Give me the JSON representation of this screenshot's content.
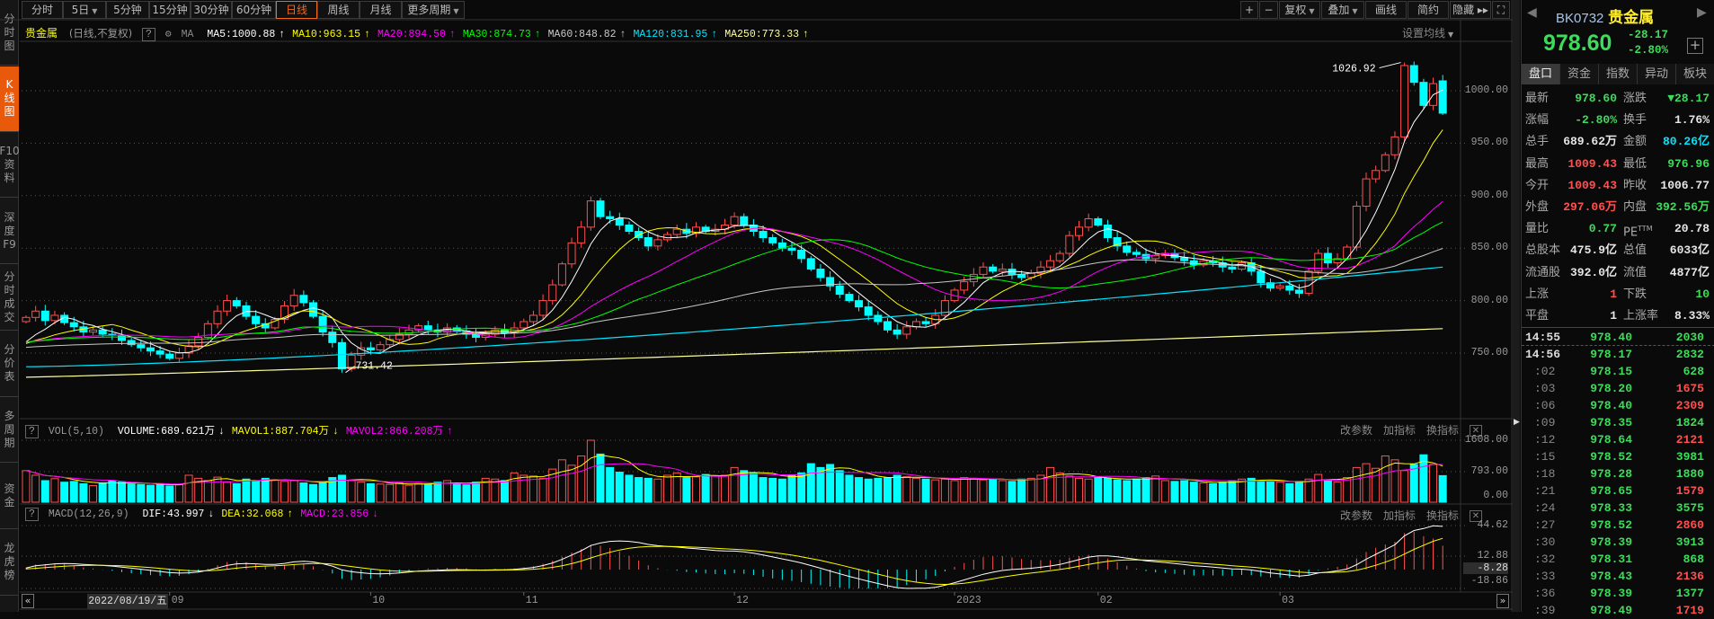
{
  "sidebar": {
    "items": [
      {
        "label": "分\n时\n图",
        "active": false
      },
      {
        "label": "K\n线\n图",
        "active": true
      },
      {
        "label": "F10\n资\n料",
        "active": false
      },
      {
        "label": "深\n度\nF9",
        "active": false
      },
      {
        "label": "分\n时\n成\n交",
        "active": false
      },
      {
        "label": "分\n价\n表",
        "active": false
      },
      {
        "label": "多\n周\n期",
        "active": false
      },
      {
        "label": "资\n金",
        "active": false
      },
      {
        "label": "龙\n虎\n榜",
        "active": false
      }
    ]
  },
  "toolbar": {
    "periods": [
      {
        "label": "分时",
        "caret": false,
        "active": false
      },
      {
        "label": "5日",
        "caret": true,
        "active": false
      },
      {
        "label": "5分钟",
        "caret": false,
        "active": false
      },
      {
        "label": "15分钟",
        "caret": false,
        "active": false
      },
      {
        "label": "30分钟",
        "caret": false,
        "active": false
      },
      {
        "label": "60分钟",
        "caret": false,
        "active": false
      },
      {
        "label": "日线",
        "caret": false,
        "active": true
      },
      {
        "label": "周线",
        "caret": false,
        "active": false
      },
      {
        "label": "月线",
        "caret": false,
        "active": false
      },
      {
        "label": "更多周期",
        "caret": true,
        "active": false
      }
    ],
    "right_buttons": [
      {
        "label": "+",
        "caret": false,
        "icon": "zoom-in"
      },
      {
        "label": "−",
        "caret": false,
        "icon": "zoom-out"
      },
      {
        "label": "复权",
        "caret": true
      },
      {
        "label": "叠加",
        "caret": true
      },
      {
        "label": "画线",
        "caret": false
      },
      {
        "label": "简约",
        "caret": false
      },
      {
        "label": "隐藏 ▸▸",
        "caret": false
      },
      {
        "label": "⛶",
        "caret": false,
        "icon": "fullscreen"
      }
    ]
  },
  "main_header": {
    "name": "贵金属",
    "mode": "(日线,不复权)",
    "help": "?",
    "ma_label": "MA",
    "ma_settings": "设置均线",
    "mas": [
      {
        "label": "MA5:1000.88",
        "arrow": "↑",
        "color": "#ffffff"
      },
      {
        "label": "MA10:963.15",
        "arrow": "↑",
        "color": "#ffff00"
      },
      {
        "label": "MA20:894.50",
        "arrow": "↑",
        "color": "#ff00ff"
      },
      {
        "label": "MA30:874.73",
        "arrow": "↑",
        "color": "#00ff00"
      },
      {
        "label": "MA60:848.82",
        "arrow": "↑",
        "color": "#c8c8c8"
      },
      {
        "label": "MA120:831.95",
        "arrow": "↑",
        "color": "#00e5ff"
      },
      {
        "label": "MA250:773.33",
        "arrow": "↑",
        "color": "#ffff99"
      }
    ]
  },
  "vol_header": {
    "help": "?",
    "name": "VOL(5,10)",
    "items": [
      {
        "label": "VOLUME:689.621万",
        "arrow": "↓",
        "color": "#ffffff"
      },
      {
        "label": "MAVOL1:887.704万",
        "arrow": "↓",
        "color": "#ffff00"
      },
      {
        "label": "MAVOL2:866.208万",
        "arrow": "↑",
        "color": "#ff00ff"
      }
    ]
  },
  "macd_header": {
    "help": "?",
    "name": "MACD(12,26,9)",
    "items": [
      {
        "label": "DIF:43.997",
        "arrow": "↓",
        "color": "#ffffff"
      },
      {
        "label": "DEA:32.068",
        "arrow": "↑",
        "color": "#ffff00"
      },
      {
        "label": "MACD:23.856",
        "arrow": "↓",
        "color": "#ff00ff"
      }
    ]
  },
  "pane_tools": {
    "edit": "改参数",
    "add": "加指标",
    "switch": "换指标",
    "close": "✕"
  },
  "axes": {
    "price_labels": [
      "1000.00",
      "950.00",
      "900.00",
      "850.00",
      "800.00",
      "750.00"
    ],
    "price_values": [
      1000,
      950,
      900,
      850,
      800,
      750
    ],
    "vol_labels": [
      "1608.00",
      "793.00",
      "0.00"
    ],
    "vol_values": [
      1608,
      793,
      0
    ],
    "macd_labels": [
      "44.62",
      "12.88",
      "-8.28",
      "-18.86"
    ],
    "macd_values": [
      44.62,
      12.88,
      -8.28,
      -18.86
    ],
    "macd_highlight": "-8.28"
  },
  "date_axis": {
    "cursor_date": "2022/08/19/五",
    "prev": "«",
    "next": "»",
    "months": [
      {
        "label": "09",
        "index": 15
      },
      {
        "label": "10",
        "index": 36
      },
      {
        "label": "11",
        "index": 52
      },
      {
        "label": "12",
        "index": 74
      },
      {
        "label": "2023",
        "index": 97
      },
      {
        "label": "02",
        "index": 112
      },
      {
        "label": "03",
        "index": 131
      }
    ]
  },
  "chart_data": {
    "type": "candlestick",
    "title": "贵金属 日线",
    "colors": {
      "up": "#ff5050",
      "down": "#00ffff"
    },
    "extremes": {
      "high": {
        "index": 144,
        "value": 1026.92,
        "label": "1026.92"
      },
      "low": {
        "index": 33,
        "value": 731.42,
        "label": "731.42"
      }
    },
    "last_open": 1009.43,
    "close": [
      784,
      790,
      781,
      786,
      779,
      775,
      770,
      772,
      768,
      767,
      762,
      758,
      755,
      752,
      749,
      745,
      750,
      757,
      765,
      778,
      790,
      800,
      795,
      785,
      778,
      774,
      782,
      795,
      805,
      798,
      785,
      770,
      760,
      735,
      748,
      755,
      753,
      758,
      763,
      768,
      772,
      776,
      772,
      770,
      774,
      771,
      768,
      765,
      768,
      772,
      769,
      774,
      780,
      786,
      800,
      815,
      835,
      855,
      870,
      895,
      880,
      878,
      872,
      866,
      860,
      852,
      858,
      863,
      868,
      864,
      870,
      866,
      868,
      872,
      880,
      872,
      866,
      860,
      855,
      850,
      848,
      840,
      830,
      822,
      814,
      806,
      800,
      794,
      786,
      780,
      772,
      768,
      775,
      780,
      778,
      786,
      800,
      810,
      818,
      825,
      832,
      828,
      830,
      825,
      822,
      826,
      832,
      838,
      845,
      862,
      870,
      878,
      872,
      860,
      852,
      846,
      844,
      840,
      843,
      845,
      841,
      838,
      834,
      838,
      836,
      832,
      830,
      836,
      828,
      817,
      812,
      814,
      810,
      807,
      828,
      845,
      836,
      840,
      851,
      890,
      916,
      924,
      939,
      956,
      1024,
      1008,
      986,
      1006.77,
      978.6
    ],
    "volume": [
      820,
      700,
      560,
      610,
      520,
      540,
      480,
      430,
      500,
      560,
      520,
      470,
      460,
      440,
      480,
      420,
      460,
      700,
      620,
      560,
      650,
      520,
      480,
      600,
      560,
      620,
      580,
      540,
      560,
      500,
      460,
      520,
      640,
      700,
      560,
      520,
      480,
      470,
      460,
      500,
      440,
      480,
      470,
      520,
      560,
      480,
      450,
      520,
      620,
      600,
      560,
      760,
      700,
      680,
      620,
      860,
      1100,
      960,
      1200,
      1608,
      1250,
      900,
      780,
      700,
      640,
      620,
      600,
      700,
      760,
      640,
      660,
      720,
      680,
      700,
      900,
      820,
      760,
      640,
      620,
      600,
      700,
      760,
      1000,
      900,
      980,
      820,
      700,
      640,
      600,
      620,
      640,
      700,
      660,
      620,
      600,
      580,
      600,
      560,
      640,
      620,
      580,
      600,
      560,
      540,
      600,
      620,
      700,
      900,
      760,
      680,
      620,
      600,
      640,
      620,
      580,
      560,
      600,
      640,
      680,
      560,
      540,
      560,
      520,
      500,
      480,
      520,
      560,
      600,
      620,
      560,
      540,
      520,
      480,
      540,
      600,
      720,
      580,
      520,
      640,
      900,
      1000,
      880,
      1200,
      1100,
      820,
      980,
      1230,
      980,
      690
    ],
    "ma_end": {
      "ma120": 831.95,
      "ma250": 773.33
    }
  },
  "quote": {
    "code": "BK0732",
    "name": "贵金属",
    "price": "978.60",
    "change": "-28.17",
    "pct": "-2.80%",
    "prev": "◀",
    "next": "▶",
    "add": "+",
    "tabs": [
      {
        "label": "盘口",
        "active": true
      },
      {
        "label": "资金"
      },
      {
        "label": "指数"
      },
      {
        "label": "异动"
      },
      {
        "label": "板块"
      }
    ],
    "rows": [
      {
        "l1": "最新",
        "v1": "978.60",
        "c1": "g",
        "l2": "涨跌",
        "v2": "▼28.17",
        "c2": "g"
      },
      {
        "l1": "涨幅",
        "v1": "-2.80%",
        "c1": "g",
        "l2": "换手",
        "v2": "1.76%",
        "c2": "w"
      },
      {
        "l1": "总手",
        "v1": "689.62万",
        "c1": "w",
        "l2": "金额",
        "v2": "80.26亿",
        "c2": "c"
      },
      {
        "l1": "最高",
        "v1": "1009.43",
        "c1": "r",
        "l2": "最低",
        "v2": "976.96",
        "c2": "g"
      },
      {
        "l1": "今开",
        "v1": "1009.43",
        "c1": "r",
        "l2": "昨收",
        "v2": "1006.77",
        "c2": "w"
      },
      {
        "l1": "外盘",
        "v1": "297.06万",
        "c1": "r",
        "l2": "内盘",
        "v2": "392.56万",
        "c2": "g"
      },
      {
        "l1": "量比",
        "v1": "0.77",
        "c1": "g",
        "l2": "PE",
        "sup": "TTM",
        "v2": "20.78",
        "c2": "w"
      },
      {
        "l1": "总股本",
        "v1": "475.9亿",
        "c1": "w",
        "l2": "总值",
        "v2": "6033亿",
        "c2": "w"
      },
      {
        "l1": "流通股",
        "v1": "392.0亿",
        "c1": "w",
        "l2": "流值",
        "v2": "4877亿",
        "c2": "w"
      },
      {
        "l1": "上涨",
        "v1": "1",
        "c1": "r",
        "l2": "下跌",
        "v2": "10",
        "c2": "g"
      },
      {
        "l1": "平盘",
        "v1": "1",
        "c1": "w",
        "l2": "上涨率",
        "v2": "8.33%",
        "c2": "w"
      }
    ],
    "ticks": [
      {
        "t": "14:55",
        "p": "978.40",
        "q": "2030",
        "c": "g"
      },
      {
        "t": "14:56",
        "p": "978.17",
        "q": "2832",
        "c": "g"
      },
      {
        "t": ":02",
        "p": "978.15",
        "q": "628",
        "c": "g"
      },
      {
        "t": ":03",
        "p": "978.20",
        "q": "1675",
        "c": "r"
      },
      {
        "t": ":06",
        "p": "978.40",
        "q": "2309",
        "c": "r"
      },
      {
        "t": ":09",
        "p": "978.35",
        "q": "1824",
        "c": "g"
      },
      {
        "t": ":12",
        "p": "978.64",
        "q": "2121",
        "c": "r"
      },
      {
        "t": ":15",
        "p": "978.52",
        "q": "3981",
        "c": "g"
      },
      {
        "t": ":18",
        "p": "978.28",
        "q": "1880",
        "c": "g"
      },
      {
        "t": ":21",
        "p": "978.65",
        "q": "1579",
        "c": "r"
      },
      {
        "t": ":24",
        "p": "978.33",
        "q": "3575",
        "c": "g"
      },
      {
        "t": ":27",
        "p": "978.52",
        "q": "2860",
        "c": "r"
      },
      {
        "t": ":30",
        "p": "978.39",
        "q": "3913",
        "c": "g"
      },
      {
        "t": ":32",
        "p": "978.31",
        "q": "868",
        "c": "g"
      },
      {
        "t": ":33",
        "p": "978.43",
        "q": "2136",
        "c": "r"
      },
      {
        "t": ":36",
        "p": "978.39",
        "q": "1377",
        "c": "g"
      },
      {
        "t": ":39",
        "p": "978.49",
        "q": "1719",
        "c": "r"
      }
    ]
  }
}
